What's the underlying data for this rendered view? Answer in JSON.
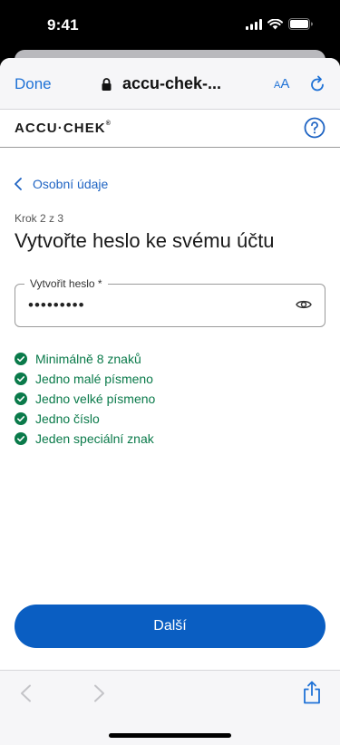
{
  "status": {
    "time": "9:41"
  },
  "safari": {
    "done_label": "Done",
    "url": "accu-chek-...",
    "aa_small": "A",
    "aa_large": "A"
  },
  "brand": {
    "logo_main": "ACCU·CHEK",
    "logo_mark": "®"
  },
  "nav": {
    "back_label": "Osobní údaje"
  },
  "step": {
    "label": "Krok 2 z 3"
  },
  "title": "Vytvořte heslo ke svému účtu",
  "password": {
    "label": "Vytvořit heslo *",
    "value": "•••••••••"
  },
  "rules": [
    {
      "label": "Minimálně 8 znaků"
    },
    {
      "label": "Jedno malé písmeno"
    },
    {
      "label": "Jedno velké písmeno"
    },
    {
      "label": "Jedno číslo"
    },
    {
      "label": "Jeden speciální znak"
    }
  ],
  "primary_button": {
    "label": "Další"
  },
  "colors": {
    "accent": "#0a5ec2",
    "link": "#1f64c3",
    "success": "#0a7a4a",
    "safari_blue": "#1f72d6"
  },
  "icons": [
    "cellular-icon",
    "wifi-icon",
    "battery-icon",
    "lock-icon",
    "reload-icon",
    "help-icon",
    "chevron-left-icon",
    "eye-icon",
    "check-circle-icon",
    "share-icon"
  ]
}
